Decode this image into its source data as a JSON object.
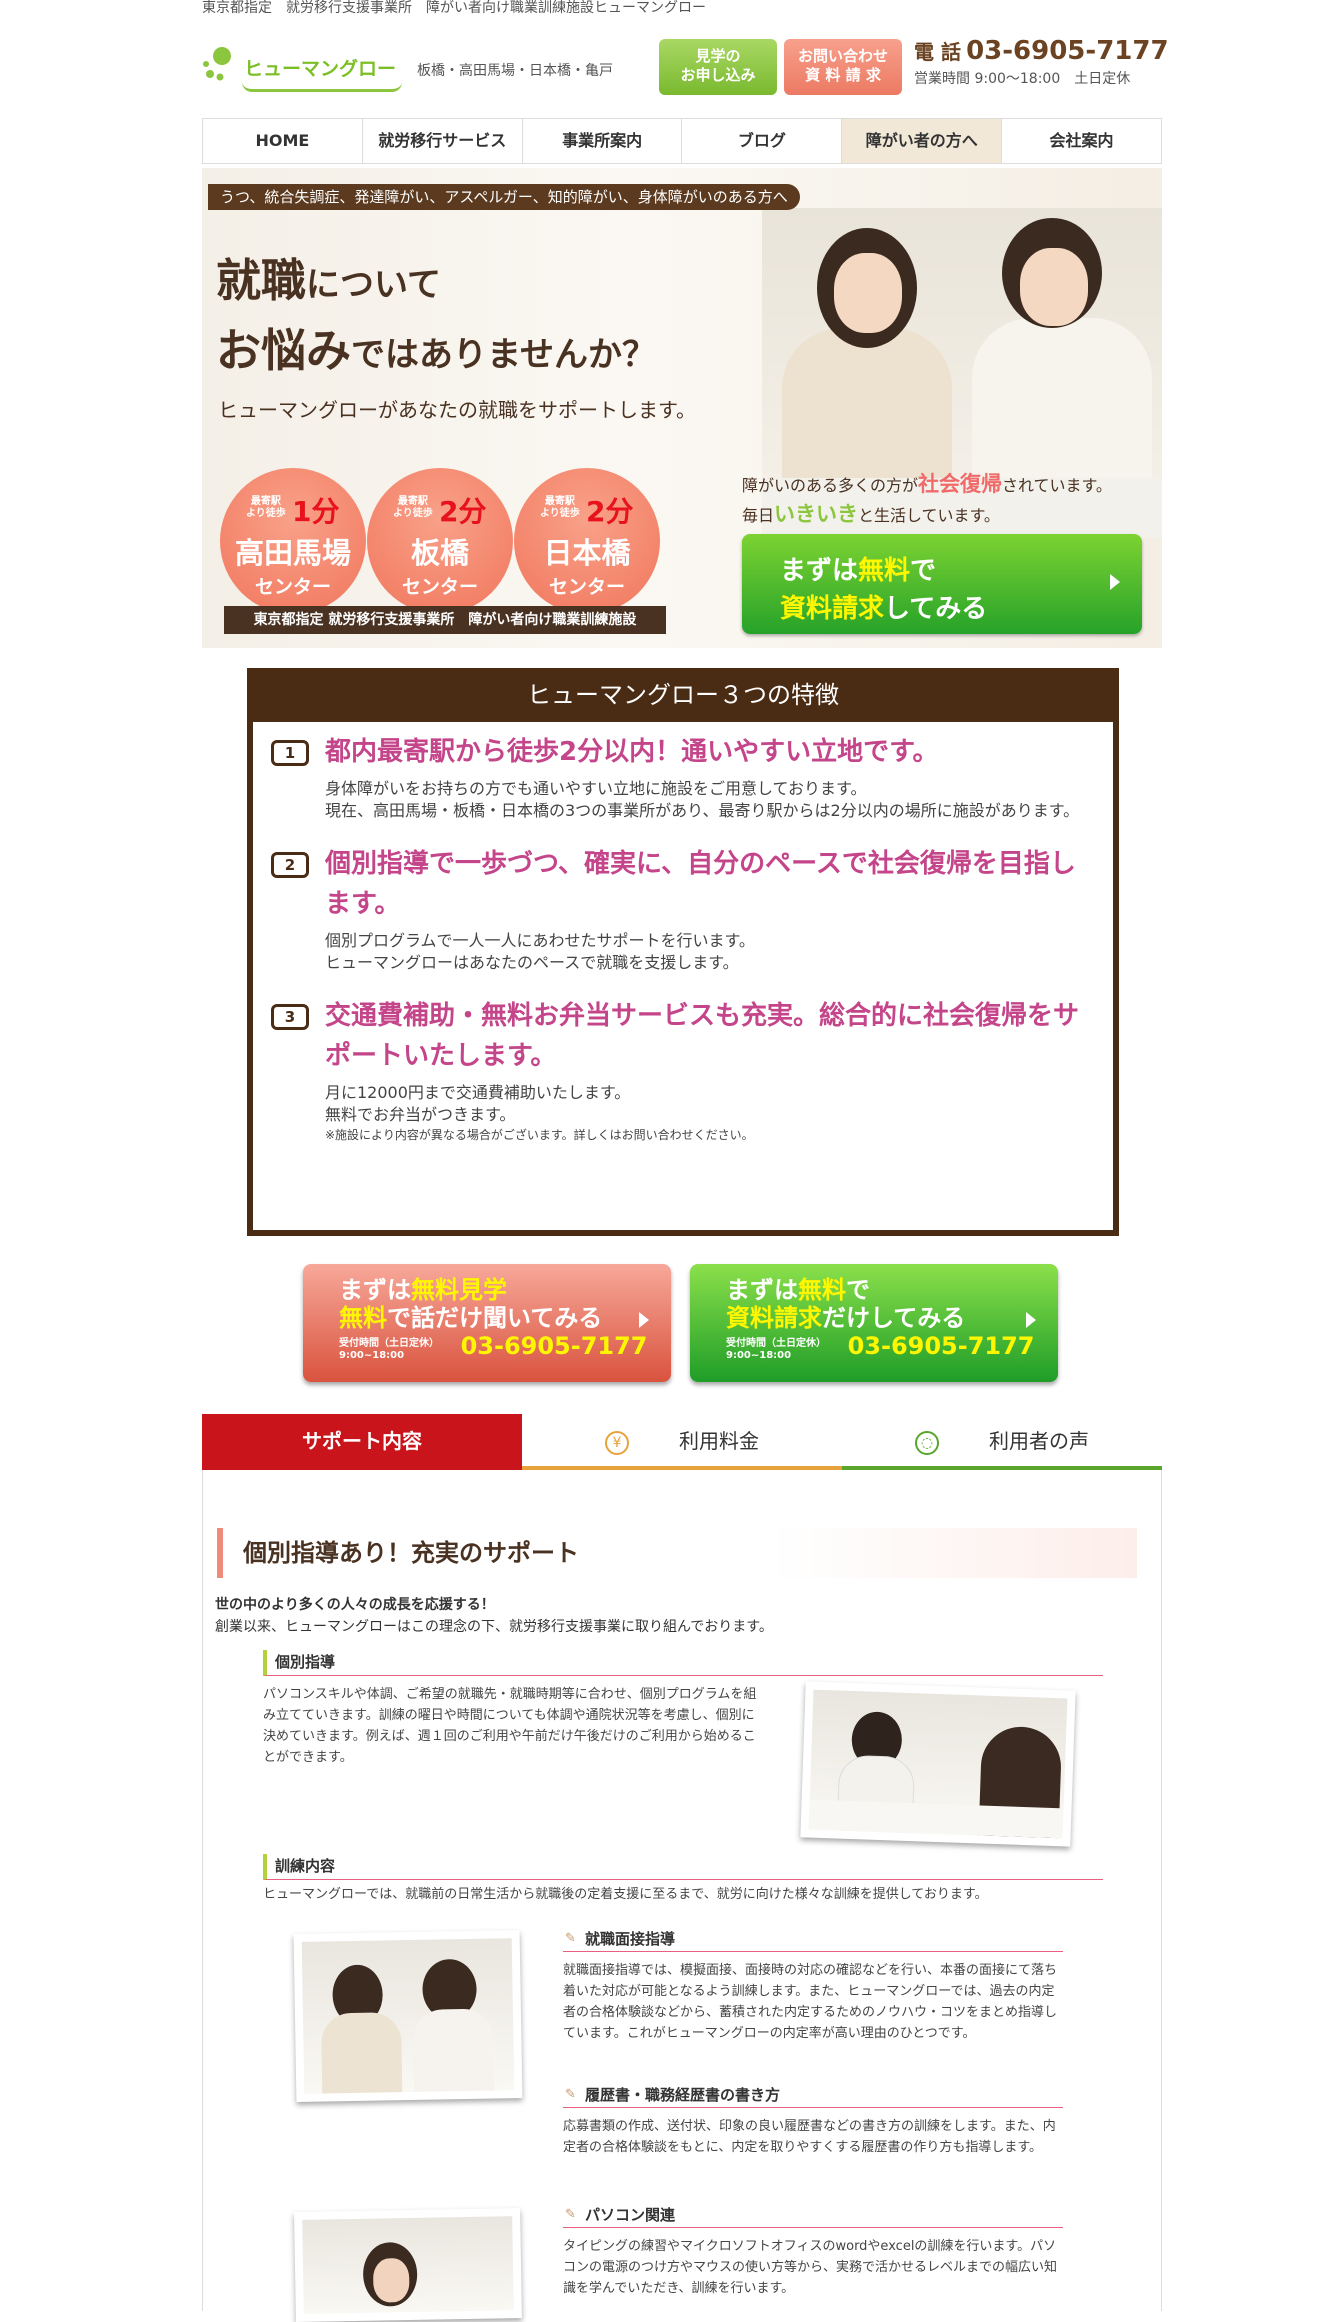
{
  "topbar": {
    "text": "東京都指定　就労移行支援事業所　障がい者向け職業訓練施設ヒューマングロー"
  },
  "header": {
    "logo_text": "ヒューマングロー",
    "areas": "板橋・高田馬場・日本橋・亀戸",
    "btn_visit_1": "見学の",
    "btn_visit_2": "お申し込み",
    "btn_contact_1": "お問い合わせ",
    "btn_contact_2": "資 料 請 求",
    "tel_label": "電 話",
    "tel_number": "03-6905-7177",
    "hours": "営業時間 9:00〜18:00　土日定休"
  },
  "nav": [
    {
      "label": "HOME"
    },
    {
      "label": "就労移行サービス"
    },
    {
      "label": "事業所案内"
    },
    {
      "label": "ブログ"
    },
    {
      "label": "障がい者の方へ"
    },
    {
      "label": "会社案内"
    }
  ],
  "hero": {
    "tag": "うつ、統合失調症、発達障がい、アスペルガー、知的障がい、身体障がいのある方へ",
    "h1_a": "就職",
    "h1_b": "について",
    "h1_c": "お悩み",
    "h1_d": "ではありませんか？",
    "sub": "ヒューマングローがあなたの就職をサポートします。",
    "centers": [
      {
        "near": "最寄駅\nより徒歩",
        "min": "1分",
        "name": "高田馬場",
        "center": "センター"
      },
      {
        "near": "最寄駅\nより徒歩",
        "min": "2分",
        "name": "板橋",
        "center": "センター"
      },
      {
        "near": "最寄駅\nより徒歩",
        "min": "2分",
        "name": "日本橋",
        "center": "センター"
      }
    ],
    "badge": "東京都指定 就労移行支援事業所　障がい者向け職業訓練施設",
    "line1_a": "障がいのある多くの方が",
    "line1_b": "社会復帰",
    "line1_c": "されています。",
    "line2_a": "毎日",
    "line2_b": "いきいき",
    "line2_c": "と生活しています。",
    "cta_a": "まずは",
    "cta_b": "無料",
    "cta_c": "で",
    "cta_d": "資料請求",
    "cta_e": "してみる"
  },
  "features": {
    "title": "ヒューマングロー３つの特徴",
    "items": [
      {
        "num": "1",
        "heading": "都内最寄駅から徒歩2分以内！通いやすい立地です。",
        "p1": "身体障がいをお持ちの方でも通いやすい立地に施設をご用意しております。",
        "p2": "現在、高田馬場・板橋・日本橋の3つの事業所があり、最寄り駅からは2分以内の場所に施設があります。"
      },
      {
        "num": "2",
        "heading": "個別指導で一歩づつ、確実に、自分のペースで社会復帰を目指します。",
        "p1": "個別プログラムで一人一人にあわせたサポートを行います。",
        "p2": "ヒューマングローはあなたのペースで就職を支援します。"
      },
      {
        "num": "3",
        "heading": "交通費補助・無料お弁当サービスも充実。総合的に社会復帰をサポートいたします。",
        "p1": "月に12000円まで交通費補助いたします。",
        "p2": "無料でお弁当がつきます。"
      }
    ],
    "note": "※施設により内容が異なる場合がございます。詳しくはお問い合わせください。"
  },
  "cta_pink": {
    "a": "まずは",
    "b": "無料見学",
    "c": "無料",
    "d": "で話だけ聞いてみる",
    "reception": "受付時間（土日定休）",
    "hours": "9:00~18:00",
    "tel": "03-6905-7177"
  },
  "cta_green": {
    "a": "まずは",
    "b": "無料",
    "c": "で",
    "d": "資料請求",
    "e": "だけしてみる",
    "reception": "受付時間（土日定休）",
    "hours": "9:00~18:00",
    "tel": "03-6905-7177"
  },
  "tabs": [
    {
      "label": "サポート内容",
      "icon": ""
    },
    {
      "label": "利用料金",
      "icon": "¥"
    },
    {
      "label": "利用者の声",
      "icon": "◌"
    }
  ],
  "support": {
    "title": "個別指導あり！充実のサポート",
    "intro_bold": "世の中のより多くの人々の成長を応援する！",
    "intro": "創業以来、ヒューマングローはこの理念の下、就労移行支援事業に取り組んでおります。",
    "individual_h": "個別指導",
    "individual_p": "パソコンスキルや体調、ご希望の就職先・就職時期等に合わせ、個別プログラムを組み立てていきます。訓練の曜日や時間についても体調や通院状況等を考慮し、個別に決めていきます。例えば、週１回のご利用や午前だけ午後だけのご利用から始めることができます。",
    "training_h": "訓練内容",
    "training_p": "ヒューマングローでは、就職前の日常生活から就職後の定着支援に至るまで、就労に向けた様々な訓練を提供しております。",
    "interview_h": "就職面接指導",
    "interview_p": "就職面接指導では、模擬面接、面接時の対応の確認などを行い、本番の面接にて落ち着いた対応が可能となるよう訓練します。また、ヒューマングローでは、過去の内定者の合格体験談などから、蓄積された内定するためのノウハウ・コツをまとめ指導しています。これがヒューマングローの内定率が高い理由のひとつです。",
    "resume_h": "履歴書・職務経歴書の書き方",
    "resume_p": "応募書類の作成、送付状、印象の良い履歴書などの書き方の訓練をします。また、内定者の合格体験談をもとに、内定を取りやすくする履歴書の作り方も指導します。",
    "pc_h": "パソコン関連",
    "pc_p": "タイピングの練習やマイクロソフトオフィスのwordやexcelの訓練を行います。パソコンの電源のつけ方やマウスの使い方等から、実務で活かせるレベルまでの幅広い知識を学んでいただき、訓練を行います。"
  }
}
